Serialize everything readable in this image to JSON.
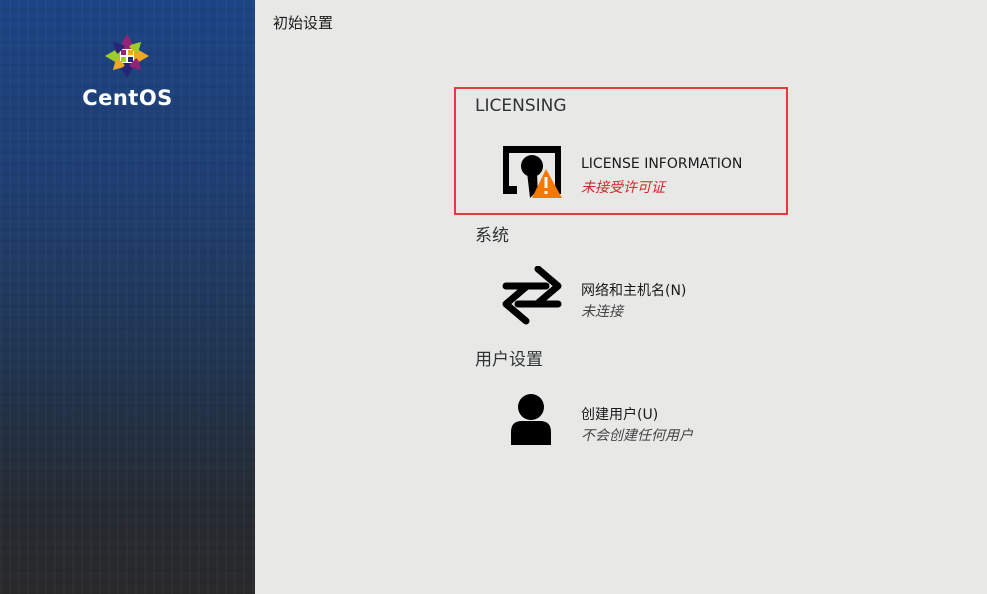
{
  "sidebar": {
    "logo_text": "CentOS"
  },
  "header": {
    "title": "初始设置"
  },
  "sections": [
    {
      "title": "LICENSING",
      "spokes": [
        {
          "label": "LICENSE INFORMATION",
          "status": "未接受许可证",
          "icon": "license-warning-icon",
          "status_color": "#d6252a"
        }
      ]
    },
    {
      "title": "系统",
      "spokes": [
        {
          "label": "网络和主机名(N)",
          "status": "未连接",
          "icon": "network-arrows-icon"
        }
      ]
    },
    {
      "title": "用户设置",
      "spokes": [
        {
          "label": "创建用户(U)",
          "status": "不会创建任何用户",
          "icon": "user-icon"
        }
      ]
    }
  ],
  "colors": {
    "highlight": "#e03c3c",
    "warning": "#f57900"
  }
}
